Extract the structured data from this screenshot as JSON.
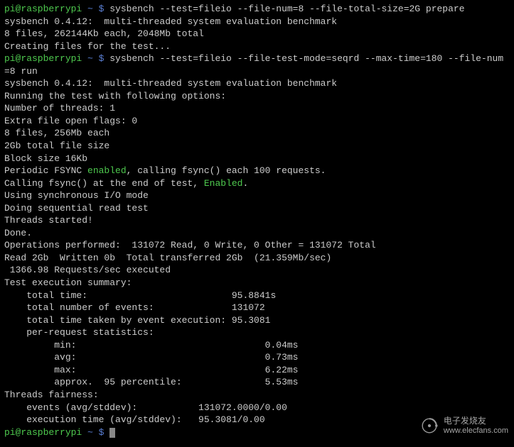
{
  "prompt": {
    "user": "pi@raspberrypi",
    "sep": " ~ $ "
  },
  "commands": {
    "cmd1": "sysbench --test=fileio --file-num=8 --file-total-size=2G prepare",
    "cmd2_part1": "sysbench --test=fileio --file-test-mode=seqrd --max-time=180 --file-num",
    "cmd2_part2": "=8 run"
  },
  "output": {
    "banner1": "sysbench 0.4.12:  multi-threaded system evaluation benchmark",
    "blank": "",
    "files_info": "8 files, 262144Kb each, 2048Mb total",
    "creating": "Creating files for the test...",
    "banner2": "sysbench 0.4.12:  multi-threaded system evaluation benchmark",
    "running": "Running the test with following options:",
    "threads": "Number of threads: 1",
    "extra_flags": "Extra file open flags: 0",
    "files_each": "8 files, 256Mb each",
    "total_size": "2Gb total file size",
    "block_size": "Block size 16Kb",
    "fsync1_a": "Periodic FSYNC ",
    "fsync1_green": "enabled",
    "fsync1_b": ", calling fsync() each 100 requests.",
    "fsync2_a": "Calling fsync() at the end of test, ",
    "fsync2_green": "Enabled",
    "fsync2_b": ".",
    "sync_io": "Using synchronous I/O mode",
    "seq_read": "Doing sequential read test",
    "threads_started": "Threads started!",
    "done": "Done.",
    "ops": "Operations performed:  131072 Read, 0 Write, 0 Other = 131072 Total",
    "read_written": "Read 2Gb  Written 0b  Total transferred 2Gb  (21.359Mb/sec)",
    "req_sec": " 1366.98 Requests/sec executed",
    "summary_hdr": "Test execution summary:",
    "total_time": "    total time:                          95.8841s",
    "total_events": "    total number of events:              131072",
    "event_exec": "    total time taken by event execution: 95.3081",
    "per_req_hdr": "    per-request statistics:",
    "stat_min": "         min:                                  0.04ms",
    "stat_avg": "         avg:                                  0.73ms",
    "stat_max": "         max:                                  6.22ms",
    "stat_p95": "         approx.  95 percentile:               5.53ms",
    "fairness_hdr": "Threads fairness:",
    "events_fair": "    events (avg/stddev):           131072.0000/0.00",
    "exec_fair": "    execution time (avg/stddev):   95.3081/0.00"
  },
  "watermark": {
    "cn": "电子发烧友",
    "url": "www.elecfans.com"
  }
}
